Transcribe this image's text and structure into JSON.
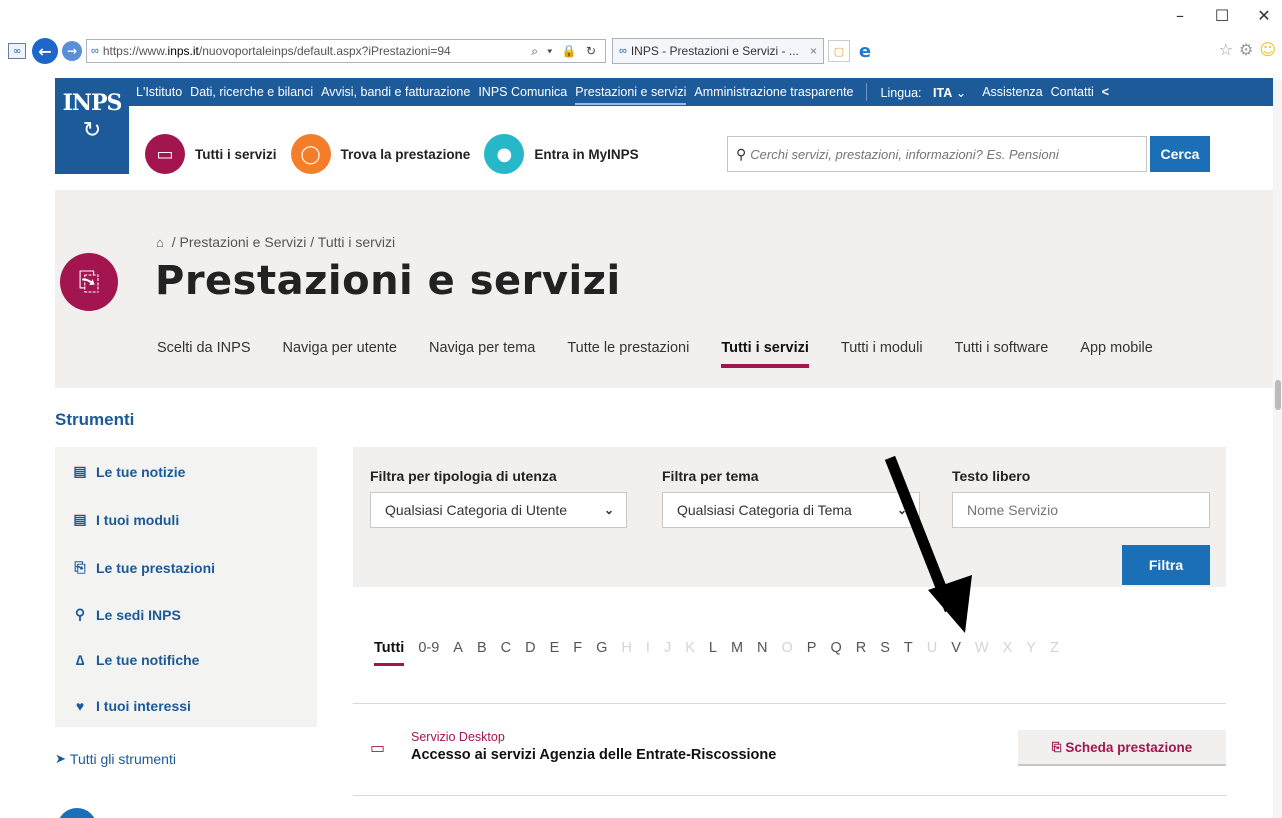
{
  "browser": {
    "url_prefix": "https://www.",
    "url_host": "inps.it",
    "url_path": "/nuovoportaleinps/default.aspx?iPrestazioni=94",
    "address_tools": "⌕ ▾ 🔒 ↻",
    "tab_title": "INPS - Prestazioni e Servizi - ...",
    "tab_close": "×",
    "window_controls": [
      "–",
      "☐",
      "✕"
    ]
  },
  "topnav": {
    "items": [
      "L'Istituto",
      "Dati, ricerche e bilanci",
      "Avvisi, bandi e fatturazione",
      "INPS Comunica",
      "Prestazioni e servizi",
      "Amministrazione trasparente"
    ],
    "lingua_label": "Lingua:",
    "lingua_value": "ITA",
    "assistenza": "Assistenza",
    "contatti": "Contatti"
  },
  "logo": {
    "text": "INPS"
  },
  "quick_links": [
    "Tutti i servizi",
    "Trova la prestazione",
    "Entra in MyINPS"
  ],
  "search": {
    "placeholder": "Cerchi servizi, prestazioni, informazioni? Es. Pensioni",
    "button": "Cerca"
  },
  "breadcrumb": [
    "Prestazioni e Servizi",
    "Tutti i servizi"
  ],
  "page_title": "Prestazioni e servizi",
  "subnav": [
    "Scelti da INPS",
    "Naviga per utente",
    "Naviga per tema",
    "Tutte le prestazioni",
    "Tutti i servizi",
    "Tutti i moduli",
    "Tutti i software",
    "App mobile"
  ],
  "sidebar": {
    "title": "Strumenti",
    "items": [
      "Le tue notizie",
      "I tuoi moduli",
      "Le tue prestazioni",
      "Le sedi INPS",
      "Le tue notifiche",
      "I tuoi interessi"
    ],
    "all_tools": "Tutti gli strumenti"
  },
  "filters": {
    "utenza_label": "Filtra per tipologia di utenza",
    "utenza_value": "Qualsiasi Categoria di Utente",
    "tema_label": "Filtra per tema",
    "tema_value": "Qualsiasi Categoria di Tema",
    "testo_label": "Testo libero",
    "testo_placeholder": "Nome Servizio",
    "button": "Filtra"
  },
  "alphabet": {
    "letters": [
      "Tutti",
      "0-9",
      "A",
      "B",
      "C",
      "D",
      "E",
      "F",
      "G",
      "H",
      "I",
      "J",
      "K",
      "L",
      "M",
      "N",
      "O",
      "P",
      "Q",
      "R",
      "S",
      "T",
      "U",
      "V",
      "W",
      "X",
      "Y",
      "Z"
    ],
    "disabled": [
      "H",
      "I",
      "J",
      "K",
      "O",
      "U",
      "W",
      "X",
      "Y",
      "Z"
    ],
    "selected": "Tutti"
  },
  "service": {
    "type": "Servizio Desktop",
    "name": "Accesso ai servizi Agenzia delle Entrate-Riscossione",
    "button": "Scheda prestazione"
  },
  "colors": {
    "brand_blue": "#1d5a9a",
    "accent_magenta": "#a3154f",
    "button_blue": "#1b6fb6"
  }
}
